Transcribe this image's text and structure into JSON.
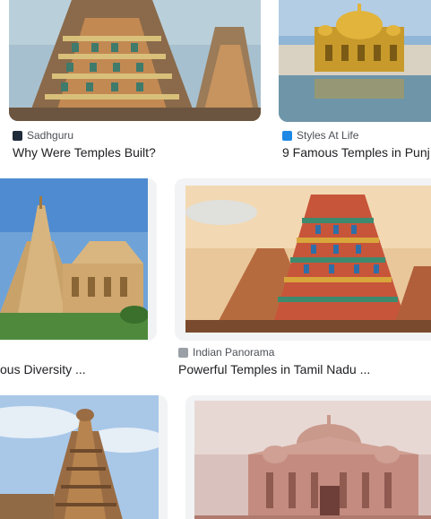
{
  "results": [
    {
      "source": "Sadhguru",
      "source_icon": "sadhguru-favicon-icon",
      "title": "Why Were Temples Built?",
      "image_subject": "colorful-gopuram-temple-tower"
    },
    {
      "source": "Styles At Life",
      "source_icon": "styles-at-life-favicon-icon",
      "title": "9 Famous Temples in Punj",
      "image_subject": "golden-temple-amritsar"
    },
    {
      "source": "",
      "source_icon": "",
      "title": "ous Diversity ...",
      "image_subject": "sandstone-temple-with-tall-spire"
    },
    {
      "source": "Indian Panorama",
      "source_icon": "indian-panorama-favicon-icon",
      "title": "Powerful Temples in Tamil Nadu ...",
      "image_subject": "painted-gopuram-sunset"
    },
    {
      "source": "",
      "source_icon": "",
      "title": "",
      "image_subject": "brihadeeswarar-stone-tower"
    },
    {
      "source": "",
      "source_icon": "",
      "title": "",
      "image_subject": "pink-sandstone-akshardham-temple"
    }
  ],
  "colors": {
    "text_primary": "#202124",
    "text_secondary": "#4d5156",
    "card_frame": "#f1f3f4"
  }
}
